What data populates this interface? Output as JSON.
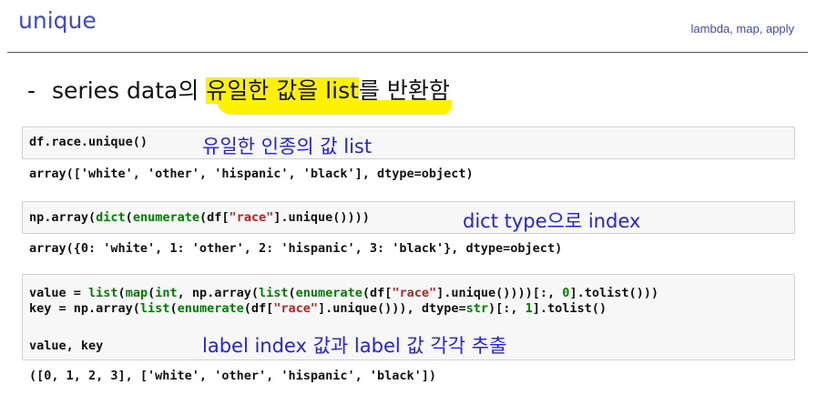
{
  "header": {
    "title": "unique",
    "tag": "lambda, map, apply"
  },
  "bullet": {
    "dash": "-",
    "text_plain": "series data의 ",
    "text_highlight": "유일한 값을 list",
    "text_end": "를 반환함"
  },
  "cells": [
    {
      "code": "df.race.unique()",
      "annotation": "유일한 인종의 값 list",
      "output": "array(['white', 'other', 'hispanic', 'black'], dtype=object)"
    },
    {
      "code_parts": [
        "np.array(",
        "dict",
        "(",
        "enumerate",
        "(df[",
        "\"race\"",
        "].unique())))"
      ],
      "annotation": "dict type으로 index",
      "output": "array({0: 'white', 1: 'other', 2: 'hispanic', 3: 'black'}, dtype=object)"
    },
    {
      "line1_parts": [
        "value = ",
        "list",
        "(",
        "map",
        "(",
        "int",
        ", np.array(",
        "list",
        "(",
        "enumerate",
        "(df[",
        "\"race\"",
        "].unique())))[:, ",
        "0",
        "].tolist()))"
      ],
      "line2_parts": [
        "key = np.array(",
        "list",
        "(",
        "enumerate",
        "(df[",
        "\"race\"",
        "].unique())), dtype=",
        "str",
        ")[:, ",
        "1",
        "].tolist()"
      ],
      "line3": "value, key",
      "annotation": "label index 값과 label 값 각각 추출",
      "output": "([0, 1, 2, 3], ['white', 'other', 'hispanic', 'black'])"
    }
  ]
}
